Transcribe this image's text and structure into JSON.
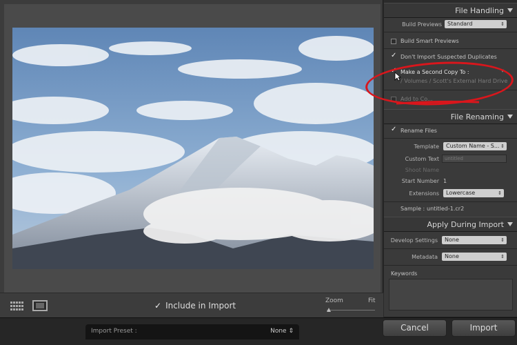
{
  "preview": {
    "include_label": "Include in Import",
    "zoom_label": "Zoom",
    "fit_label": "Fit"
  },
  "footer": {
    "preset_label": "Import Preset :",
    "preset_value": "None",
    "cancel_label": "Cancel",
    "import_label": "Import"
  },
  "file_handling": {
    "title": "File Handling",
    "build_previews_label": "Build Previews",
    "build_previews_value": "Standard",
    "build_smart_previews_label": "Build Smart Previews",
    "dont_import_label": "Don't Import Suspected Duplicates",
    "second_copy_label": "Make a Second Copy To :",
    "second_copy_path": "/ Volumes / Scott's External Hard Drive",
    "add_to_label": "Add to Co..."
  },
  "file_renaming": {
    "title": "File Renaming",
    "rename_label": "Rename Files",
    "template_label": "Template",
    "template_value": "Custom Name - S...",
    "custom_text_label": "Custom Text",
    "custom_text_value": "untitled",
    "shoot_name_label": "Shoot Name",
    "start_number_label": "Start Number",
    "start_number_value": "1",
    "extensions_label": "Extensions",
    "extensions_value": "Lowercase",
    "sample_label": "Sample :",
    "sample_value": "untitled-1.cr2"
  },
  "apply_during_import": {
    "title": "Apply During Import",
    "develop_label": "Develop Settings",
    "develop_value": "None",
    "metadata_label": "Metadata",
    "metadata_value": "None",
    "keywords_label": "Keywords"
  },
  "colors": {
    "annotation": "#d9161c"
  }
}
